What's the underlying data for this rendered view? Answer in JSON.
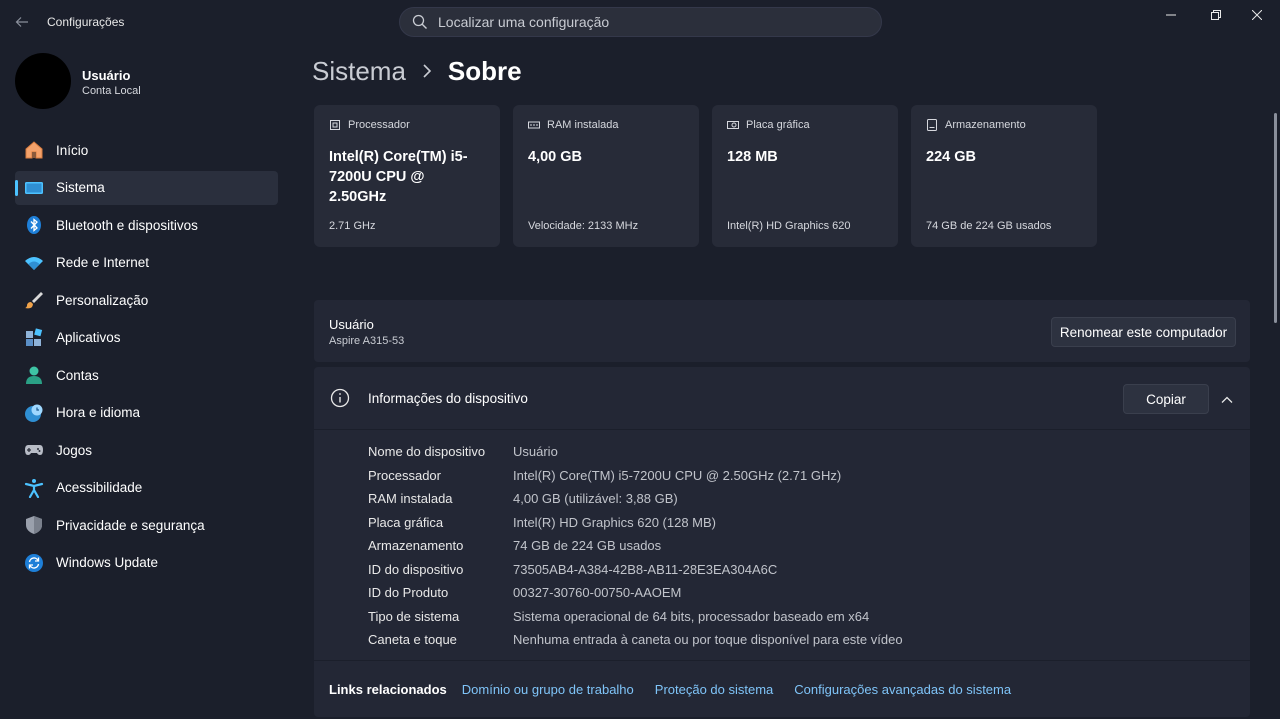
{
  "titlebar": {
    "app_title": "Configurações",
    "search_placeholder": "Localizar uma configuração"
  },
  "profile": {
    "name": "Usuário",
    "account_type": "Conta Local"
  },
  "sidebar": {
    "items": [
      {
        "label": "Início",
        "icon": "home-icon"
      },
      {
        "label": "Sistema",
        "icon": "system-icon",
        "active": true
      },
      {
        "label": "Bluetooth e dispositivos",
        "icon": "bluetooth-icon"
      },
      {
        "label": "Rede e Internet",
        "icon": "wifi-icon"
      },
      {
        "label": "Personalização",
        "icon": "brush-icon"
      },
      {
        "label": "Aplicativos",
        "icon": "apps-icon"
      },
      {
        "label": "Contas",
        "icon": "accounts-icon"
      },
      {
        "label": "Hora e idioma",
        "icon": "clock-globe-icon"
      },
      {
        "label": "Jogos",
        "icon": "gamepad-icon"
      },
      {
        "label": "Acessibilidade",
        "icon": "accessibility-icon"
      },
      {
        "label": "Privacidade e segurança",
        "icon": "shield-icon"
      },
      {
        "label": "Windows Update",
        "icon": "update-icon"
      }
    ]
  },
  "breadcrumb": {
    "parent": "Sistema",
    "current": "Sobre"
  },
  "cards": [
    {
      "title": "Processador",
      "value": "Intel(R) Core(TM) i5-7200U CPU @ 2.50GHz",
      "foot": "2.71 GHz",
      "icon": "cpu-icon"
    },
    {
      "title": "RAM instalada",
      "value": "4,00 GB",
      "foot": "Velocidade: 2133 MHz",
      "icon": "ram-icon"
    },
    {
      "title": "Placa gráfica",
      "value": "128 MB",
      "foot": "Intel(R) HD Graphics 620",
      "icon": "gpu-icon"
    },
    {
      "title": "Armazenamento",
      "value": "224 GB",
      "foot": "74 GB de 224 GB usados",
      "icon": "storage-icon"
    }
  ],
  "computer": {
    "name": "Usuário",
    "model": "Aspire A315-53",
    "rename_label": "Renomear este computador"
  },
  "device_info": {
    "title": "Informações do dispositivo",
    "copy_label": "Copiar",
    "rows": [
      {
        "label": "Nome do dispositivo",
        "value": "Usuário"
      },
      {
        "label": "Processador",
        "value": "Intel(R) Core(TM) i5-7200U CPU @ 2.50GHz (2.71 GHz)"
      },
      {
        "label": "RAM instalada",
        "value": "4,00 GB (utilizável: 3,88 GB)"
      },
      {
        "label": "Placa gráfica",
        "value": "Intel(R) HD Graphics 620 (128 MB)"
      },
      {
        "label": "Armazenamento",
        "value": "74 GB de 224 GB usados"
      },
      {
        "label": "ID do dispositivo",
        "value": "73505AB4-A384-42B8-AB11-28E3EA304A6C"
      },
      {
        "label": "ID do Produto",
        "value": "00327-30760-00750-AAOEM"
      },
      {
        "label": "Tipo de sistema",
        "value": "Sistema operacional de 64 bits, processador baseado em x64"
      },
      {
        "label": "Caneta e toque",
        "value": "Nenhuma entrada à caneta ou por toque disponível para este vídeo"
      }
    ]
  },
  "related_links": {
    "label": "Links relacionados",
    "links": [
      "Domínio ou grupo de trabalho",
      "Proteção do sistema",
      "Configurações avançadas do sistema"
    ]
  },
  "colors": {
    "accent": "#4cc2ff",
    "link": "#7fc4f8",
    "background": "#1b1f2b",
    "card": "#272b38"
  }
}
